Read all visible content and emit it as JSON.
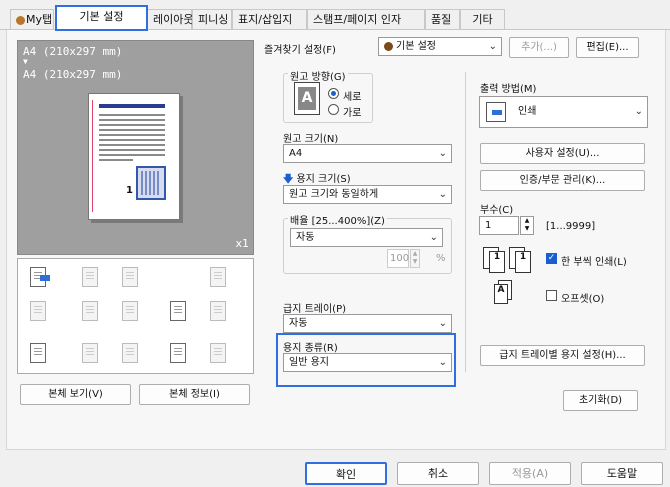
{
  "tabs": [
    {
      "label": "My탭"
    },
    {
      "label": "기본 설정"
    },
    {
      "label": "레이아웃"
    },
    {
      "label": "피니싱"
    },
    {
      "label": "표지/삽입지"
    },
    {
      "label": "스탬프/페이지 인자"
    },
    {
      "label": "품질"
    },
    {
      "label": "기타"
    }
  ],
  "preview": {
    "line1": "A4 (210x297 mm)",
    "arrow": "▼",
    "line2": "A4 (210x297 mm)",
    "copies": "x1",
    "page_number": "1"
  },
  "left_buttons": {
    "view": "본체 보기(V)",
    "info": "본체 정보(I)"
  },
  "favorites": {
    "label": "즐겨찾기 설정(F)",
    "value": "기본 설정",
    "add": "추가(...)",
    "edit": "편집(E)..."
  },
  "orientation": {
    "label": "원고 방향(G)",
    "portrait": "세로",
    "landscape": "가로"
  },
  "original_size": {
    "label": "원고 크기(N)",
    "value": "A4"
  },
  "paper_size": {
    "label": "용지 크기(S)",
    "value": "원고 크기와 동일하게"
  },
  "zoom": {
    "label": "배율 [25...400%](Z)",
    "mode": "자동",
    "value": "100",
    "unit": "%"
  },
  "paper_tray": {
    "label": "급지 트레이(P)",
    "value": "자동"
  },
  "paper_type": {
    "label": "용지 종류(R)",
    "value": "일반 용지"
  },
  "output_method": {
    "label": "출력 방법(M)",
    "value": "인쇄"
  },
  "right_buttons": {
    "user_settings": "사용자 설정(U)...",
    "auth": "인증/부문 관리(K)...",
    "tray_paper": "급지 트레이별 용지 설정(H)...",
    "reset": "초기화(D)"
  },
  "copies": {
    "label": "부수(C)",
    "value": "1",
    "range": "[1...9999]"
  },
  "collate": {
    "label": "한 부씩 인쇄(L)",
    "checked": true
  },
  "offset": {
    "label": "오프셋(O)",
    "checked": false
  },
  "footer": {
    "ok": "확인",
    "cancel": "취소",
    "apply": "적용(A)",
    "help": "도움말"
  },
  "colors": {
    "highlight": "#2f6fe0",
    "accent": "#1a5fd0"
  }
}
